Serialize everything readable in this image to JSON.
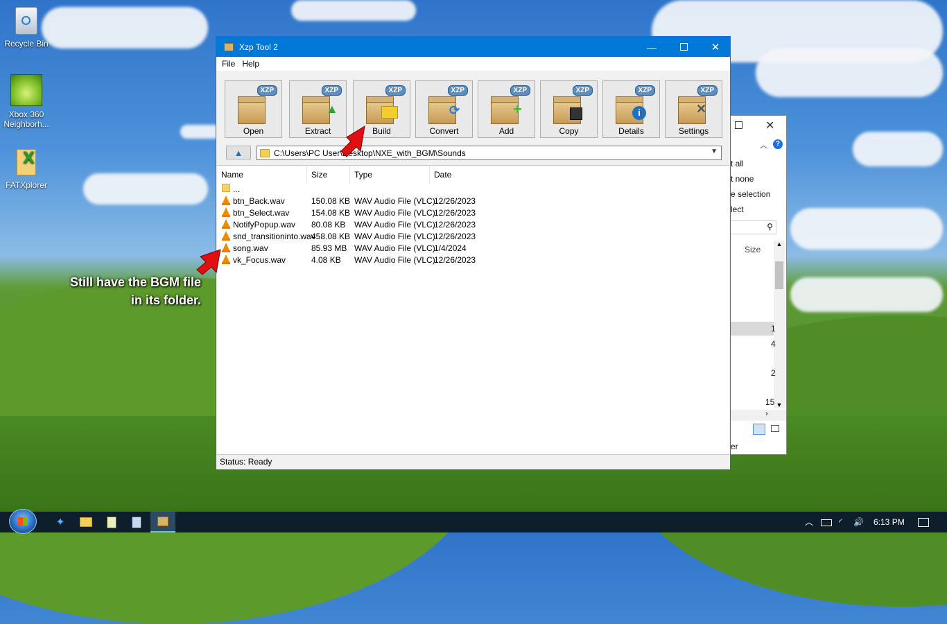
{
  "desktop": {
    "icons": [
      {
        "label": "Recycle Bin"
      },
      {
        "label": "Xbox 360 Neighborh..."
      },
      {
        "label": "FATXplorer"
      }
    ],
    "annotation": [
      "Still have the BGM file",
      "in its folder."
    ]
  },
  "background_window": {
    "items": [
      "t all",
      "t none",
      "e selection",
      "lect"
    ],
    "size_header": "Size",
    "partial_values": [
      "1",
      "4",
      "2",
      "15"
    ],
    "footer": "er"
  },
  "window": {
    "title": "Xzp Tool 2",
    "menu": [
      "File",
      "Help"
    ],
    "toolbar": [
      {
        "label": "Open",
        "badge": "XZP"
      },
      {
        "label": "Extract",
        "badge": "XZP"
      },
      {
        "label": "Build",
        "badge": "XZP"
      },
      {
        "label": "Convert",
        "badge": "XZP"
      },
      {
        "label": "Add",
        "badge": "XZP"
      },
      {
        "label": "Copy",
        "badge": "XZP"
      },
      {
        "label": "Details",
        "badge": "XZP"
      },
      {
        "label": "Settings",
        "badge": "XZP"
      }
    ],
    "path": "C:\\Users\\PC User\\Desktop\\NXE_with_BGM\\Sounds",
    "columns": [
      "Name",
      "Size",
      "Type",
      "Date"
    ],
    "rows": [
      {
        "name": "...",
        "size": "",
        "type": "",
        "date": "",
        "icon": "folder-icon"
      },
      {
        "name": "btn_Back.wav",
        "size": "150.08 KB",
        "type": "WAV Audio File (VLC)",
        "date": "12/26/2023",
        "icon": "vlc-icon"
      },
      {
        "name": "btn_Select.wav",
        "size": "154.08 KB",
        "type": "WAV Audio File (VLC)",
        "date": "12/26/2023",
        "icon": "vlc-icon"
      },
      {
        "name": "NotifyPopup.wav",
        "size": "80.08 KB",
        "type": "WAV Audio File (VLC)",
        "date": "12/26/2023",
        "icon": "vlc-icon"
      },
      {
        "name": "snd_transitioninto.wav",
        "size": "458.08 KB",
        "type": "WAV Audio File (VLC)",
        "date": "12/26/2023",
        "icon": "vlc-icon"
      },
      {
        "name": "song.wav",
        "size": "85.93 MB",
        "type": "WAV Audio File (VLC)",
        "date": "1/4/2024",
        "icon": "vlc-icon"
      },
      {
        "name": "vk_Focus.wav",
        "size": "4.08 KB",
        "type": "WAV Audio File (VLC)",
        "date": "12/26/2023",
        "icon": "vlc-icon"
      }
    ],
    "status": "Status: Ready"
  },
  "taskbar": {
    "clock": "6:13 PM"
  },
  "colors": {
    "titlebar": "#0078d7",
    "annotation_arrow": "#e01010"
  }
}
